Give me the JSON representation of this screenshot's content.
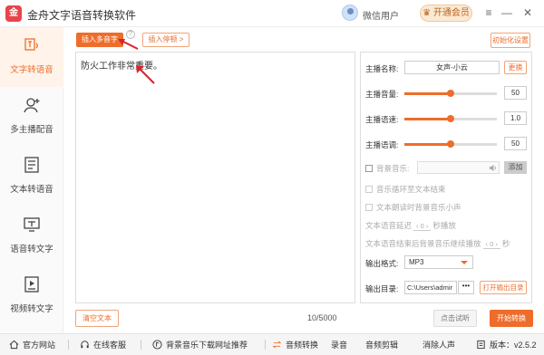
{
  "window": {
    "title": "金舟文字语音转换软件",
    "user_name": "微信用户",
    "vip_label": "开通会员",
    "minimize": "—",
    "restore": "□",
    "close": "✕"
  },
  "sidebar": {
    "items": [
      {
        "label": "文字转语音",
        "icon": "text-to-speech-icon",
        "active": true
      },
      {
        "label": "多主播配音",
        "icon": "multi-voice-icon",
        "active": false
      },
      {
        "label": "文本转语音",
        "icon": "document-icon",
        "active": false
      },
      {
        "label": "语音转文字",
        "icon": "speech-to-text-icon",
        "active": false
      },
      {
        "label": "视频转文字",
        "icon": "video-icon",
        "active": false
      }
    ]
  },
  "editor": {
    "insert_pause_label": "插入多音字",
    "help_glyph": "?",
    "insert_polyphone_label": "插入停顿 >",
    "content": "防火工作非常重要。",
    "clear_label": "清空文本",
    "char_count": "10/5000"
  },
  "settings": {
    "init_label": "初始化设置",
    "voice_label": "主播名称:",
    "voice_value": "女声-小云",
    "change_label": "更换",
    "volume_label": "主播音量:",
    "volume_value": "50",
    "volume_level": 0.5,
    "speed_label": "主播语速:",
    "speed_value": "1.0",
    "speed_level": 0.5,
    "pitch_label": "主播语调:",
    "pitch_value": "50",
    "pitch_level": 0.5,
    "bgm_label": "背景音乐:",
    "add_label": "添加",
    "loop_label": "音乐循环至文本结束",
    "lower_label": "文本朗读时背景音乐小声",
    "delay_prefix": "文本语音延迟",
    "delay_value": "0",
    "delay_suffix": "秒播放",
    "after_prefix": "文本语音结束后背景音乐继续播放",
    "after_value": "0",
    "after_suffix": "秒",
    "format_label": "输出格式:",
    "format_value": "MP3",
    "dir_label": "输出目录:",
    "dir_value": "C:\\Users\\admir",
    "dots": "•••",
    "open_dir_label": "打开输出目录",
    "preview_label": "点击试听",
    "start_label": "开始转换"
  },
  "footer": {
    "website": "官方网站",
    "service": "在线客服",
    "bgm_site": "背景音乐下载网址推荐",
    "audio_convert": "音频转换",
    "record": "录音",
    "audio_cut": "音频剪辑",
    "vocal_remove": "消除人声",
    "version": "版本：v2.5.2"
  },
  "colors": {
    "accent": "#ee6d2b",
    "annotation_arrow": "#d9232b"
  }
}
